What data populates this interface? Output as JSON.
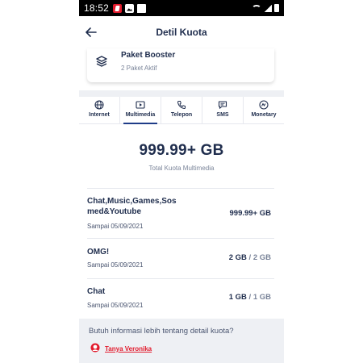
{
  "status_bar": {
    "time": "18:52"
  },
  "header": {
    "title": "Detil Kuota"
  },
  "booster": {
    "title": "Paket Booster",
    "subtitle": "2 Paket Aktif"
  },
  "tabs": [
    {
      "label": "Internet",
      "icon": "globe-icon",
      "active": false
    },
    {
      "label": "Multimedia",
      "icon": "play-icon",
      "active": true
    },
    {
      "label": "Telepon",
      "icon": "phone-icon",
      "active": false
    },
    {
      "label": "SMS",
      "icon": "message-icon",
      "active": false
    },
    {
      "label": "Monetary",
      "icon": "coin-icon",
      "active": false
    }
  ],
  "total": {
    "value": "999.99+ GB",
    "label": "Total Kuota Multimedia"
  },
  "quotas": [
    {
      "name": "Chat,Music,Games,Sos med&Youtube",
      "date": "Sampai 05/09/2021",
      "remaining": "999.99+ GB",
      "total": ""
    },
    {
      "name": "OMG!",
      "date": "Sampai 05/09/2021",
      "remaining": "2 GB",
      "total": "2 GB"
    },
    {
      "name": "Chat",
      "date": "Sampai 05/09/2021",
      "remaining": "1 GB",
      "total": "1 GB"
    }
  ],
  "info": {
    "text": "Butuh informasi lebih tentang detail kuota?",
    "link": "Tanya Veronika"
  },
  "colors": {
    "primary_text": "#1f2d4d",
    "accent_red": "#e21a2c",
    "active_tab": "#1f3c88",
    "info_bg": "#eef0f4"
  }
}
